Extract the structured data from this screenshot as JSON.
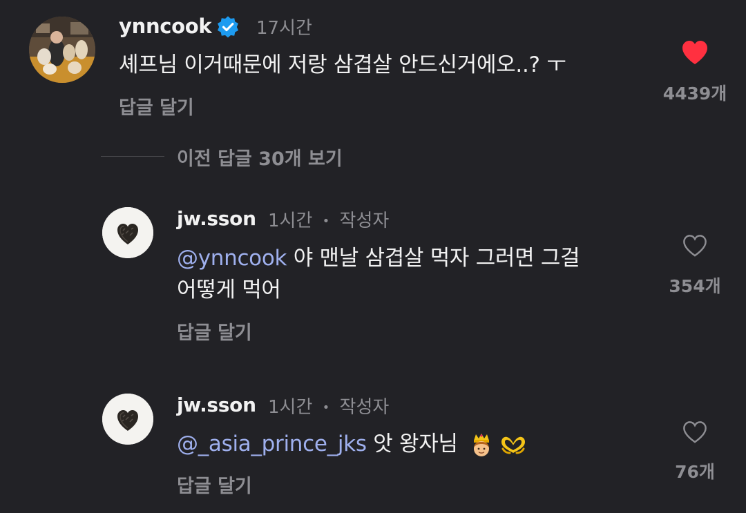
{
  "main_comment": {
    "username": "ynncook",
    "time": "17시간",
    "text": "셰프님 이거때문에 저랑 삼겹살 안드신거에오..? ㅜ",
    "reply_label": "답글 달기",
    "like_count": "4439개",
    "liked": true
  },
  "view_previous": "이전 답글 30개 보기",
  "replies": [
    {
      "username": "jw.sson",
      "time": "1시간",
      "dot": "•",
      "author_badge": "작성자",
      "mention": "@ynncook",
      "text_line1": " 야 맨날 삼겹살 먹자 그러면 그걸",
      "text_line2": "어떻게 먹어",
      "reply_label": "답글 달기",
      "like_count": "354개"
    },
    {
      "username": "jw.sson",
      "time": "1시간",
      "dot": "•",
      "author_badge": "작성자",
      "mention": "@_asia_prince_jks",
      "text_line1": " 앗 왕자님",
      "emojis": [
        "prince-emoji",
        "heart-hands-emoji"
      ],
      "reply_label": "답글 달기",
      "like_count": "76개"
    }
  ],
  "colors": {
    "background": "#222226",
    "text": "#f2f2f2",
    "muted": "#8e8e93",
    "mention": "#9fb0ee",
    "liked_heart": "#ff3040",
    "verified": "#1d9bf0"
  }
}
